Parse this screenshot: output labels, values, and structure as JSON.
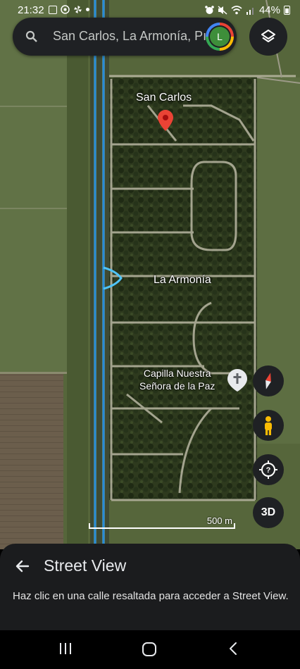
{
  "status_bar": {
    "time": "21:32",
    "battery": "44%"
  },
  "search": {
    "query": "San Carlos, La Armonía, Pı",
    "avatar_initial": "L"
  },
  "map": {
    "places": [
      {
        "id": "san-carlos",
        "label": "San Carlos"
      },
      {
        "id": "la-armonia",
        "label": "La Armonía"
      },
      {
        "id": "capilla",
        "label_line1": "Capilla Nuestra",
        "label_line2": "Señora de la Paz"
      }
    ],
    "scale_label": "500 m",
    "highlight_color": "#4fc3f7",
    "pin_color": "#ea4335"
  },
  "controls": {
    "three_d_label": "3D"
  },
  "sheet": {
    "title": "Street View",
    "description": "Haz clic en una calle resaltada para acceder a Street View."
  }
}
